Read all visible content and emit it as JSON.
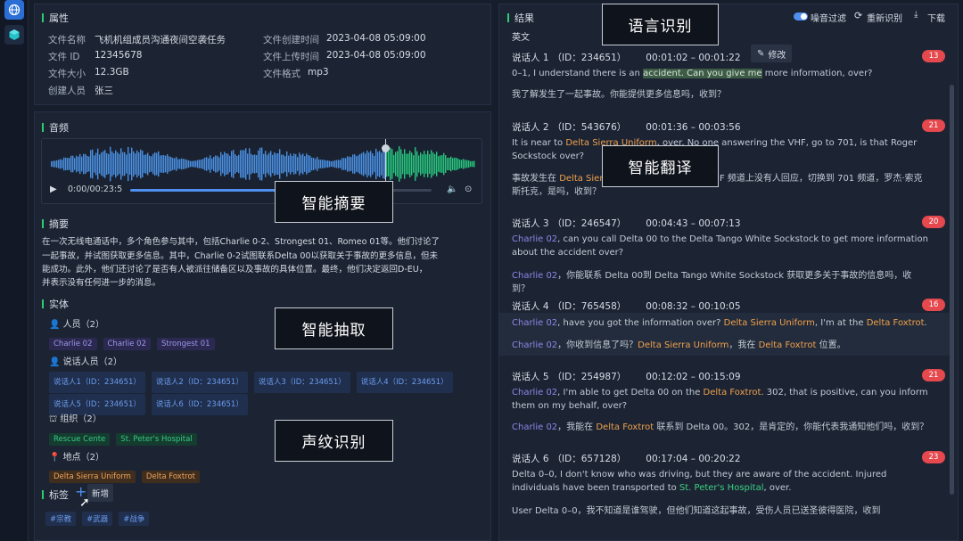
{
  "properties": {
    "title": "属性",
    "rows": [
      {
        "label": "文件名称",
        "value": "飞机机组成员沟通夜间空袭任务"
      },
      {
        "label": "文件 ID",
        "value": "12345678"
      },
      {
        "label": "文件大小",
        "value": "12.3GB"
      },
      {
        "label": "创建人员",
        "value": "张三"
      }
    ],
    "rows2": [
      {
        "label": "文件创建时间",
        "value": "2023-04-08 05:09:00"
      },
      {
        "label": "文件上传时间",
        "value": "2023-04-08 05:09:00"
      },
      {
        "label": "文件格式",
        "value": "mp3"
      }
    ]
  },
  "audio": {
    "title": "音频",
    "time": "0:00/00:23:5",
    "progress": 0.62
  },
  "summary": {
    "title": "摘要",
    "lines": [
      "在一次无线电通话中，多个角色参与其中，包括Charlie 0-2、Strongest 01、Romeo 01等。他们讨论了",
      "一起事故，并试图获取更多信息。其中，Charlie 0-2试图联系Delta 00以获取关于事故的更多信息，但未",
      "能成功。此外，他们还讨论了是否有人被派往储备区以及事故的具体位置。最终，他们决定返回D-EU，",
      "并表示没有任何进一步的消息。"
    ]
  },
  "entities": {
    "title": "实体",
    "groups": [
      {
        "label": "人员（2）",
        "tags": [
          "Charlie 02",
          "Charlie 02",
          "Strongest 01"
        ]
      },
      {
        "label": "说话人员（2）",
        "tags": [
          "说话人1（ID：234651）",
          "说话人2（ID：234651）",
          "说话人3（ID：234651）",
          "说话人4（ID：234651）",
          "说话人5（ID：234651）",
          "说话人6（ID：234651）"
        ]
      },
      {
        "label": "组织（2）",
        "tags": [
          "Rescue Cente",
          "St. Peter's Hospital"
        ]
      },
      {
        "label": "地点（2）",
        "tags": [
          "Delta Sierra Uniform",
          "Delta Foxtrot"
        ]
      }
    ]
  },
  "tags_section": {
    "title": "标签",
    "add_label": "新增",
    "tags": [
      "#宗教",
      "#武器",
      "#战争"
    ]
  },
  "results": {
    "title": "结果",
    "lang": "英文",
    "noise_label": "噪音过滤",
    "rerecognize_label": "重新识别",
    "download_label": "下载",
    "edit_label": "修改",
    "speakers": [
      {
        "name": "说话人 1",
        "id": "（ID：234651）",
        "time": "00:01:02 – 00:01:22",
        "count": "13"
      },
      {
        "name": "说话人 2",
        "id": "（ID：543676）",
        "time": "00:01:36 – 00:03:56",
        "count": "21"
      },
      {
        "name": "说话人 3",
        "id": "（ID：246547）",
        "time": "00:04:43 – 00:07:13",
        "count": "20"
      },
      {
        "name": "说话人 4",
        "id": "（ID：765458）",
        "time": "00:08:32 – 00:10:05",
        "count": "16"
      },
      {
        "name": "说话人 5",
        "id": "（ID：254987）",
        "time": "00:12:02 – 00:15:09",
        "count": "21"
      },
      {
        "name": "说话人 6",
        "id": "（ID：657128）",
        "time": "00:17:04 – 00:20:22",
        "count": "23"
      }
    ]
  },
  "overlays": {
    "lang": "语言识别",
    "translate": "智能翻译",
    "summary": "智能摘要",
    "extract": "智能抽取",
    "voiceprint": "声纹识别"
  }
}
